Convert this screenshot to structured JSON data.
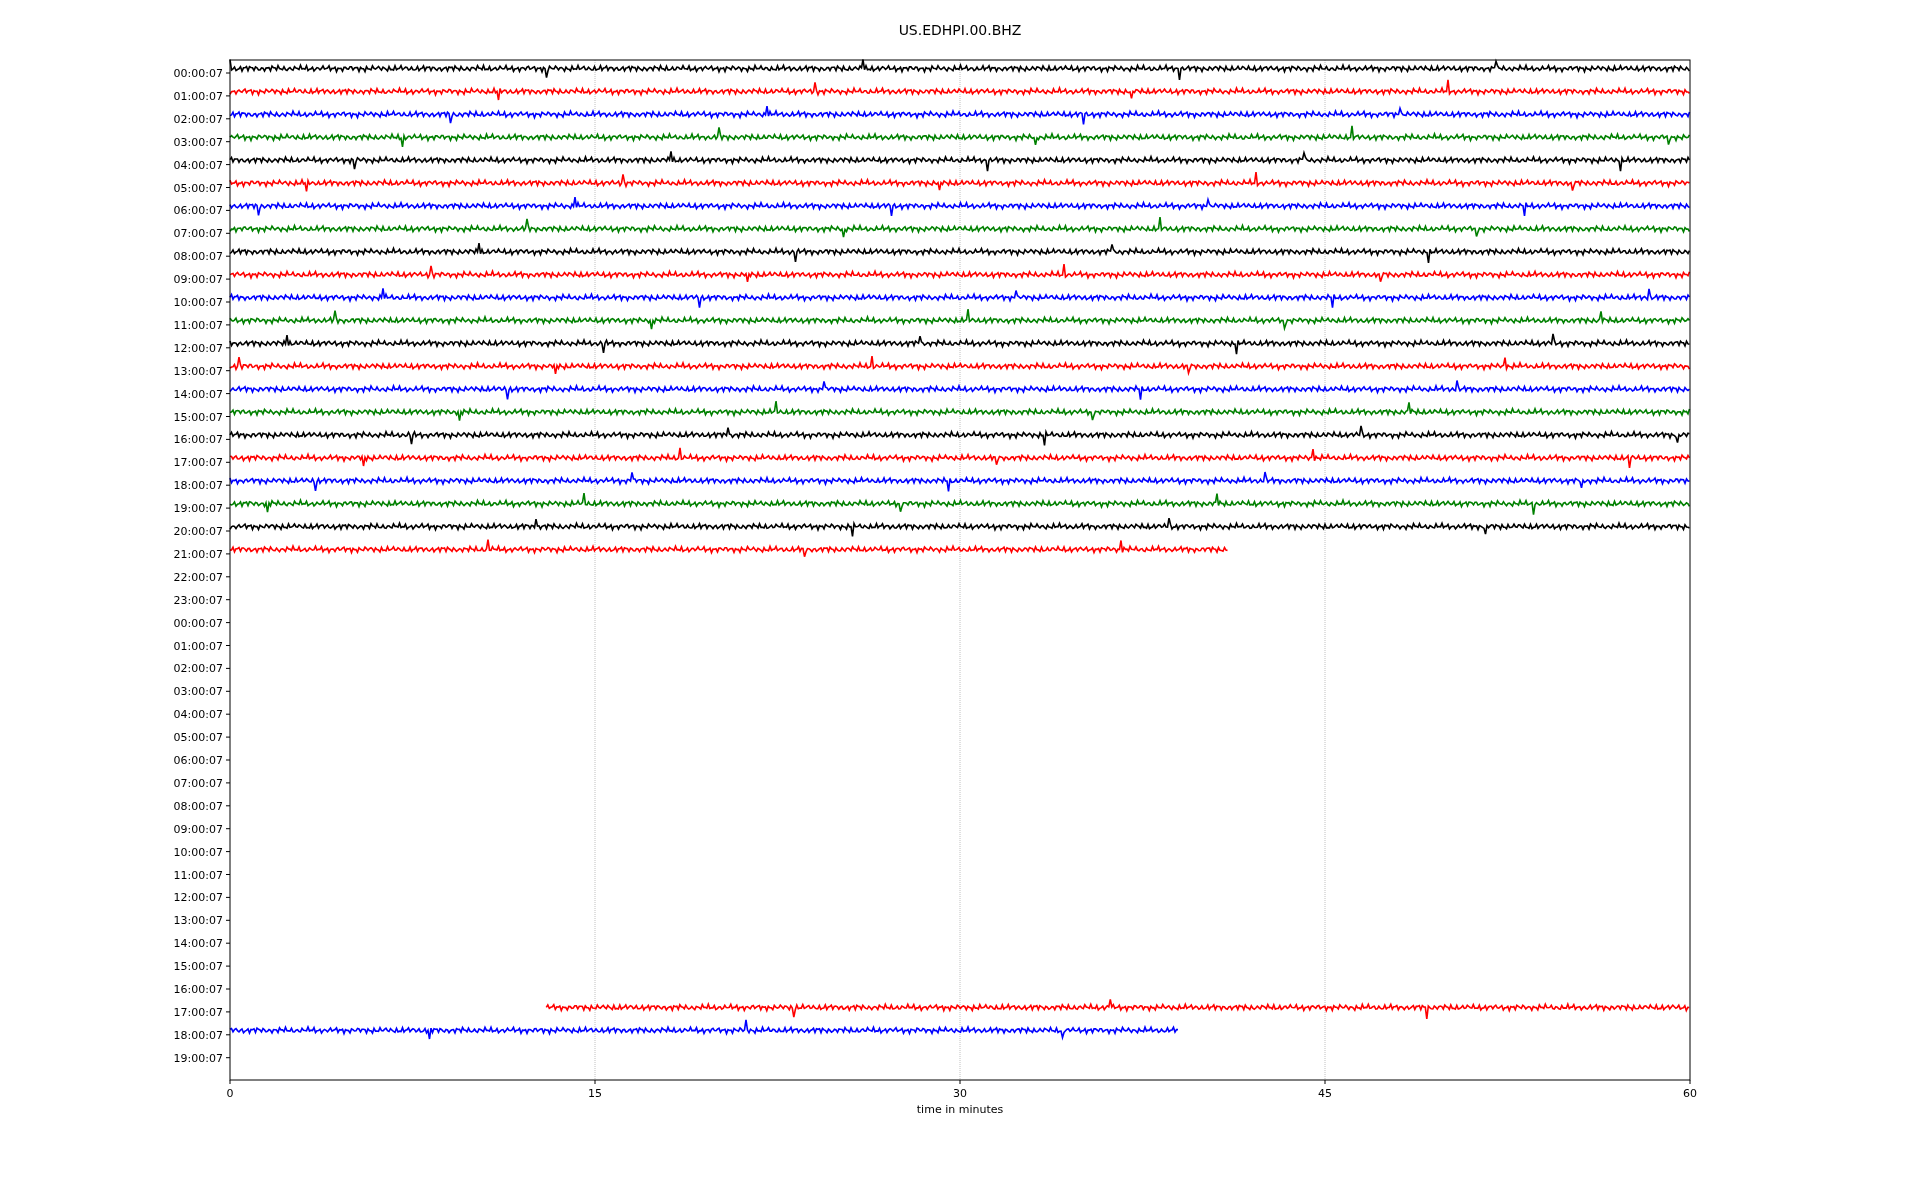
{
  "title": "US.EDHPI.00.BHZ",
  "y_labels": [
    "00:00:07",
    "01:00:07",
    "02:00:07",
    "03:00:07",
    "04:00:07",
    "05:00:07",
    "06:00:07",
    "07:00:07",
    "08:00:07",
    "09:00:07",
    "10:00:07",
    "11:00:07",
    "12:00:07",
    "13:00:07",
    "14:00:07",
    "15:00:07",
    "16:00:07",
    "17:00:07",
    "18:00:07",
    "19:00:07",
    "20:00:07",
    "21:00:07",
    "22:00:07",
    "23:00:07",
    "00:00:07",
    "01:00:07",
    "02:00:07",
    "03:00:07",
    "04:00:07",
    "05:00:07",
    "06:00:07",
    "07:00:07",
    "08:00:07",
    "09:00:07",
    "10:00:07",
    "11:00:07",
    "12:00:07",
    "13:00:07",
    "14:00:07",
    "15:00:07",
    "16:00:07",
    "17:00:07",
    "18:00:07",
    "19:00:07"
  ],
  "x_ticks": [
    "0",
    "15",
    "30",
    "45",
    "60"
  ],
  "x_label": "time in minutes"
}
